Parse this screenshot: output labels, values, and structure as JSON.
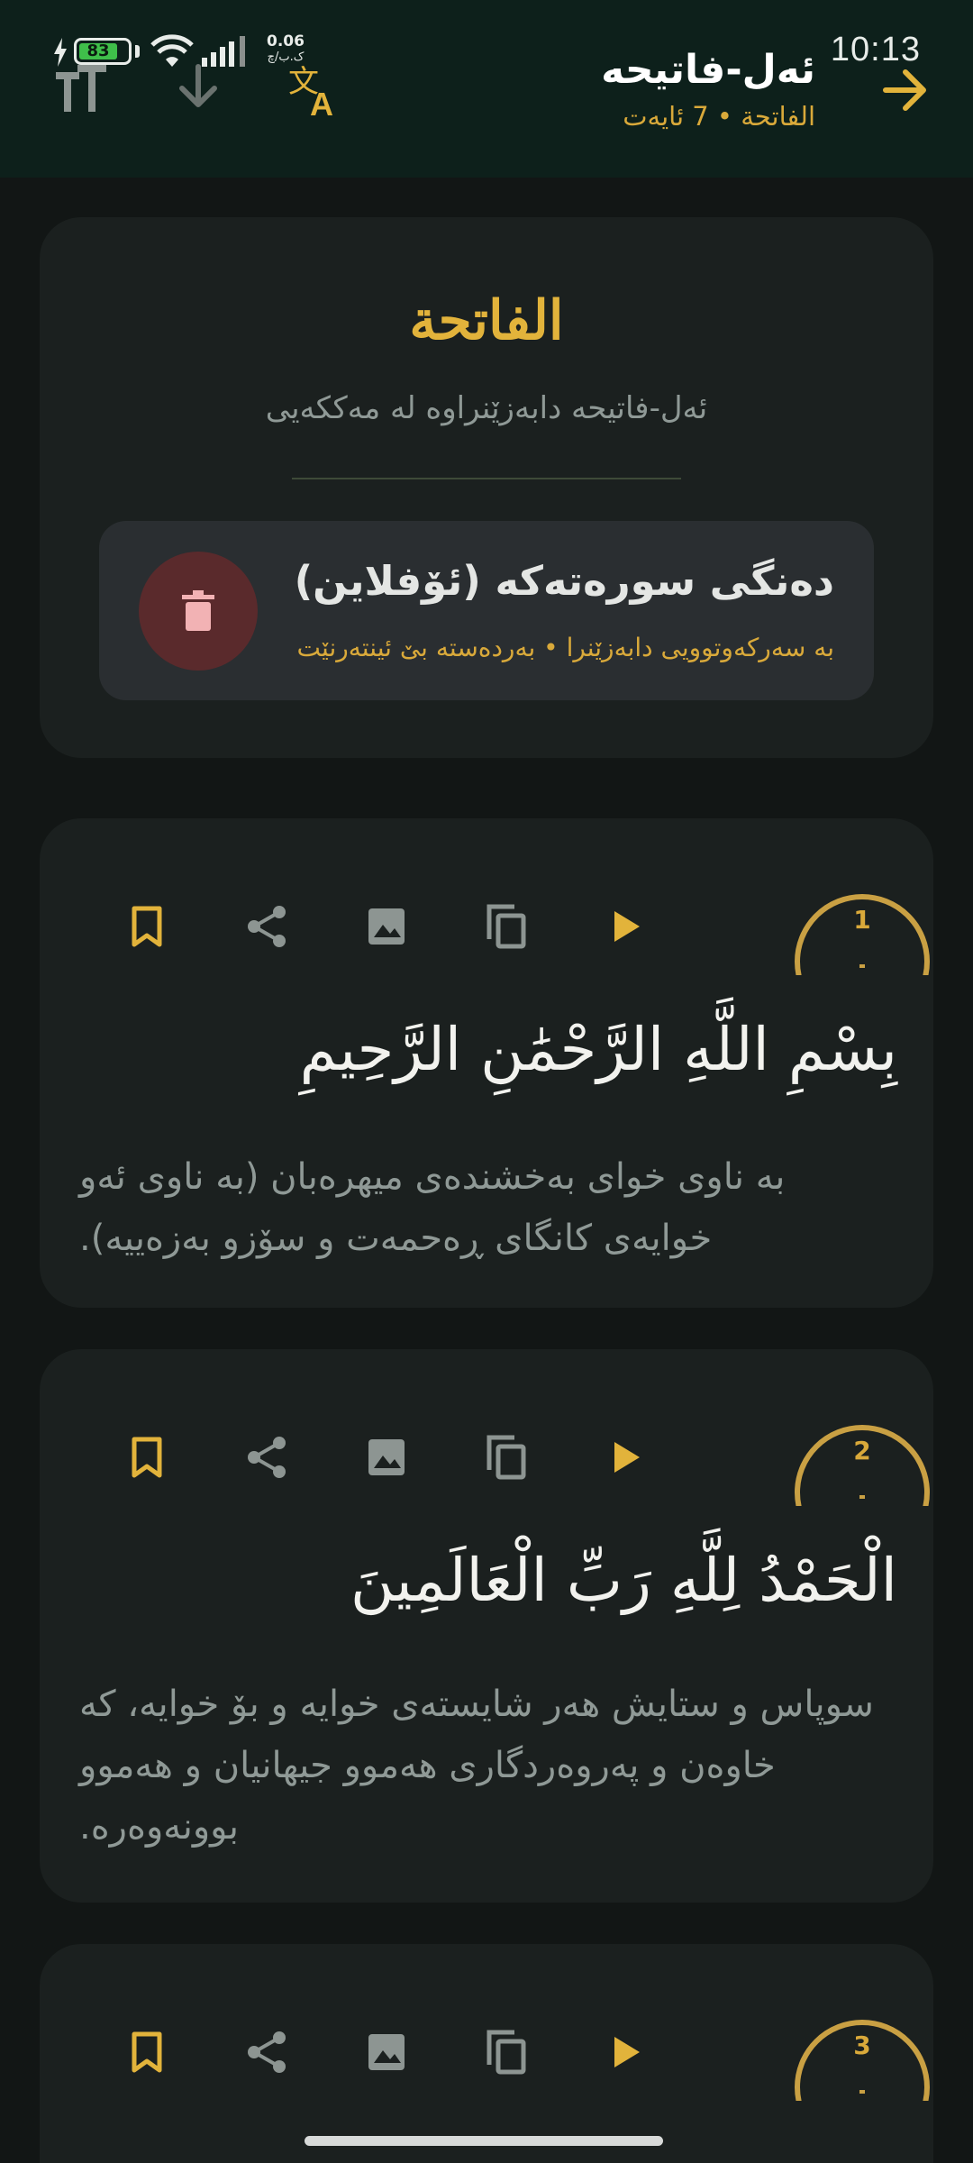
{
  "status_bar": {
    "time": "10:13",
    "battery_level": "83",
    "net_speed": "0.06",
    "net_speed_unit": "ک.ب/چ"
  },
  "header": {
    "title": "ئەل-فاتیحە",
    "subtitle": "الفاتحة • 7 ئایەت",
    "back_icon": "arrow-forward-icon",
    "translate_icon": "translate-icon",
    "download_icon": "download-icon",
    "font_size_icon": "text-size-icon"
  },
  "surah_info": {
    "arabic_name": "الفاتحة",
    "description": "ئەل-فاتیحە دابەزێنراوە لە مەککەیی",
    "audio": {
      "title": "دەنگی سورەتەکە (ئۆفلاین)",
      "subtitle": "بە سەرکەوتوویی دابەزێنرا • بەردەستە بێ ئینتەرنێت",
      "delete_icon": "trash-icon"
    }
  },
  "ayahs": [
    {
      "number": "1",
      "arabic": "بِسْمِ اللَّهِ الرَّحْمَٰنِ الرَّحِيمِ",
      "translation": "بە ناوی خوای بەخشندەی میهرەبان (بە ناوی ئەو خوایەی کانگای ڕەحمەت و سۆزو بەزەییە)."
    },
    {
      "number": "2",
      "arabic": "الْحَمْدُ لِلَّهِ رَبِّ الْعَالَمِينَ",
      "translation": "سوپاس و ستایش هەر شایستەی خوایە و بۆ خوایە، کە خاوەن و پەروەردگاری هەموو جیهانیان و هەموو بوونەوەرە."
    },
    {
      "number": "3",
      "arabic": "",
      "translation": ""
    }
  ],
  "colors": {
    "accent": "#d9a93a",
    "background": "#121615",
    "header_bg": "#0d201b",
    "card_bg": "#1b201f",
    "icon_gray": "#8d9592"
  }
}
